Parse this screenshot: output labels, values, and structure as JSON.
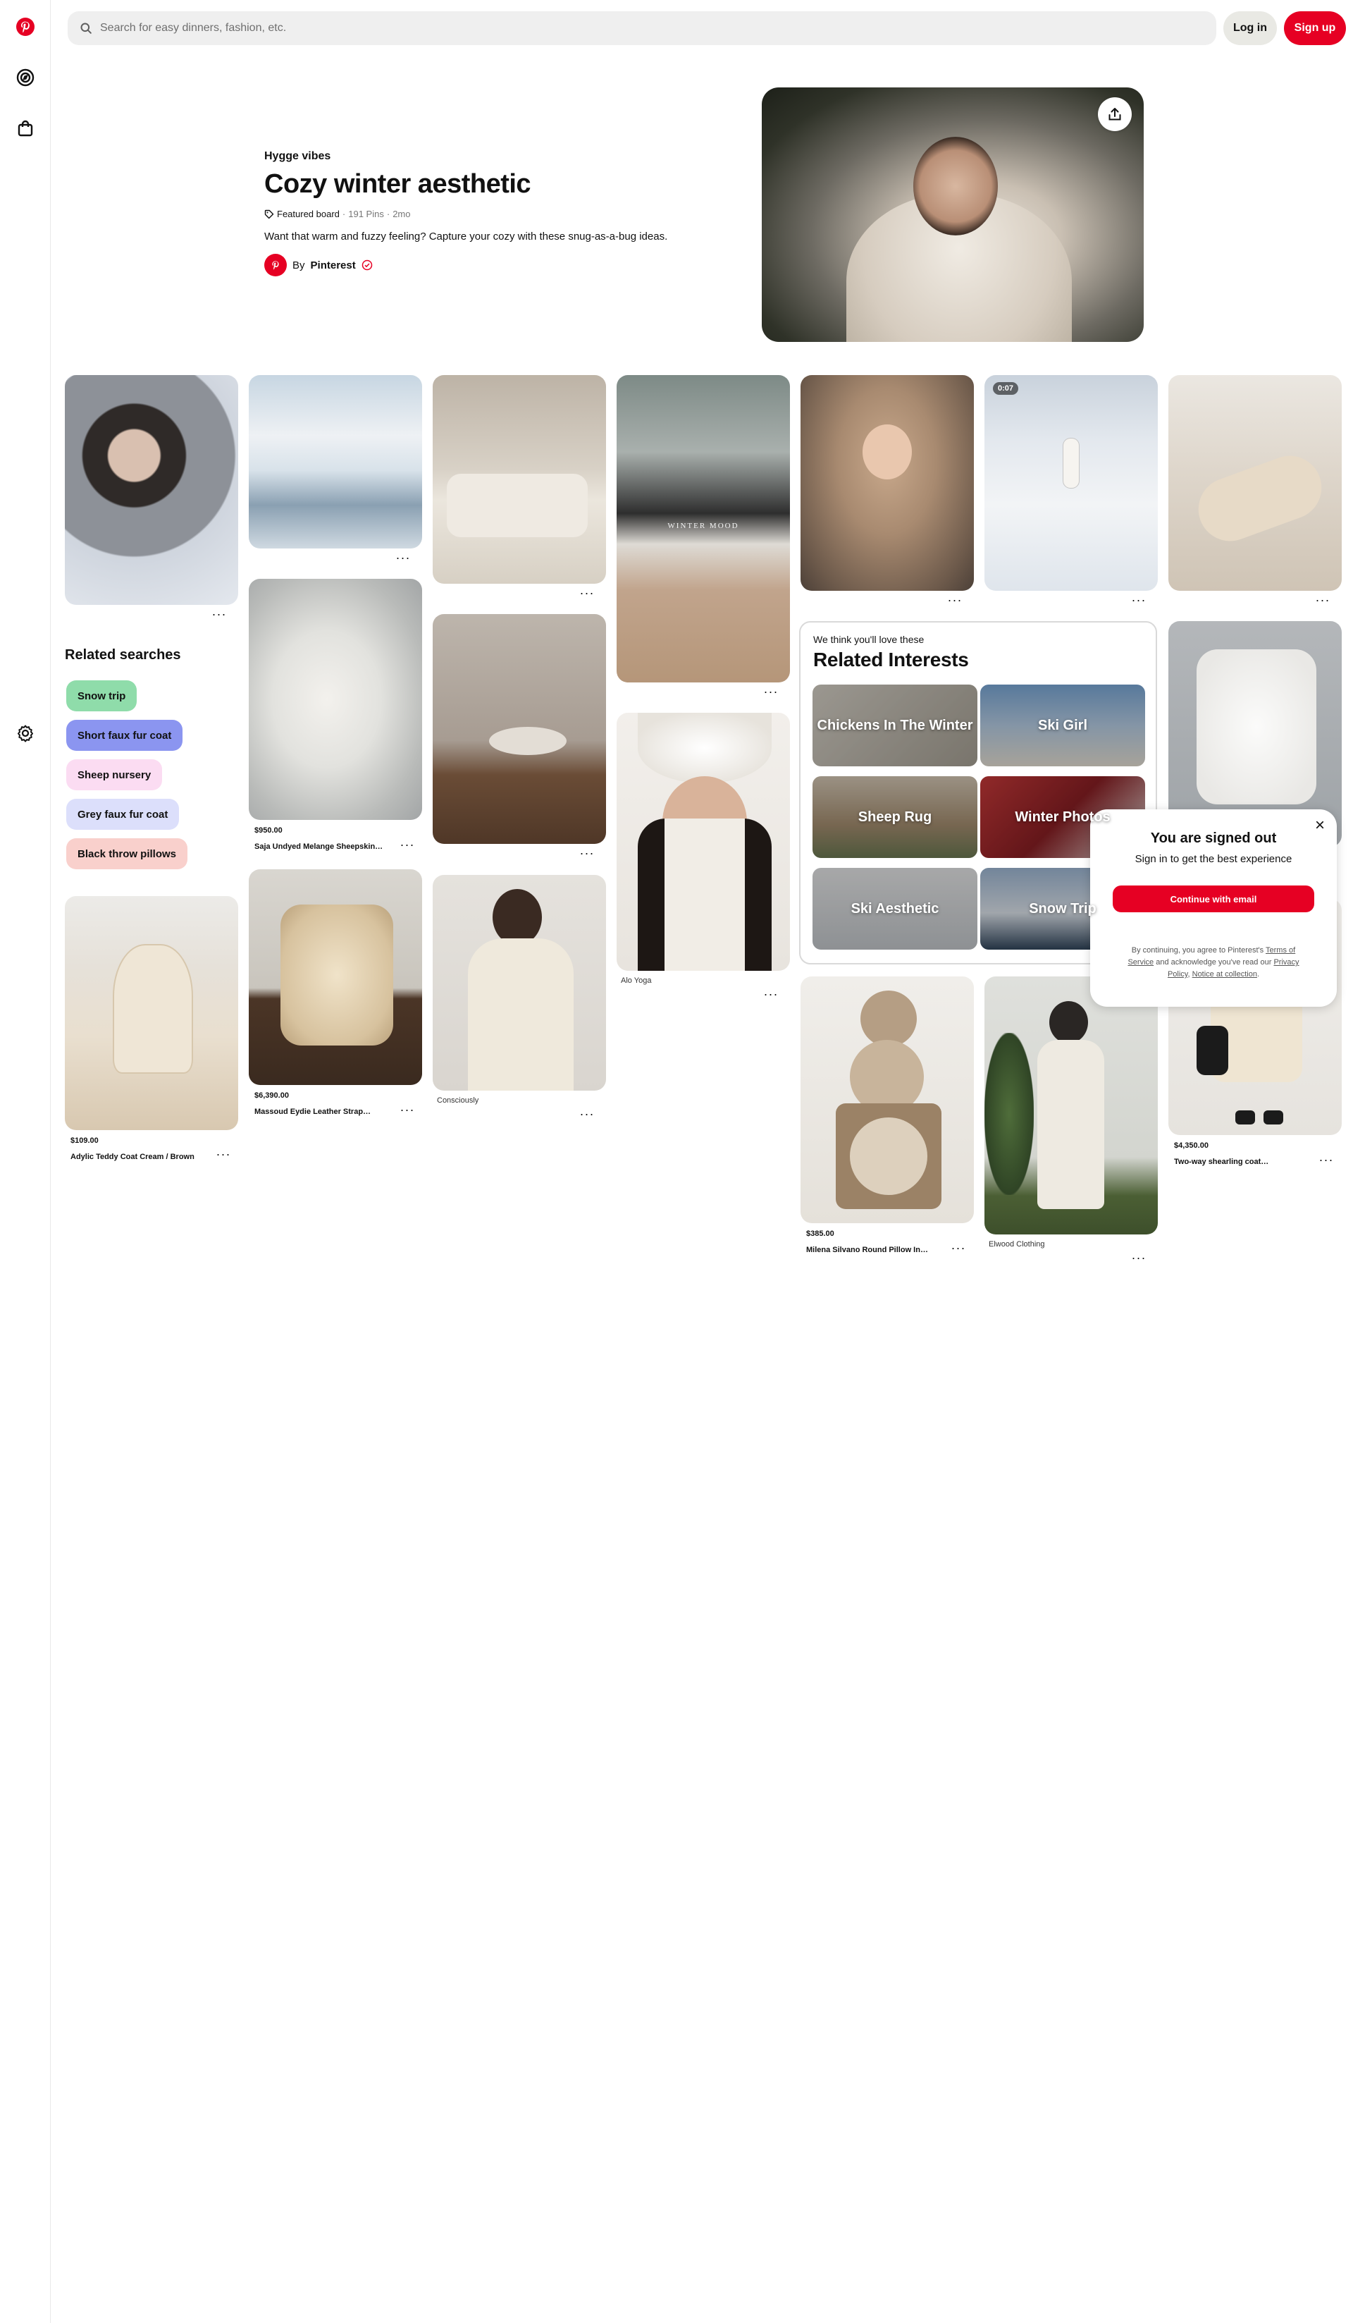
{
  "header": {
    "search_placeholder": "Search for easy dinners, fashion, etc.",
    "login_label": "Log in",
    "signup_label": "Sign up"
  },
  "rail": {
    "icons": [
      "pinterest-logo",
      "explore-compass-icon",
      "shop-bag-icon",
      "settings-gear-icon"
    ]
  },
  "board": {
    "kicker": "Hygge vibes",
    "title": "Cozy winter aesthetic",
    "featured_label": "Featured board",
    "separator": "·",
    "pin_count": "191 Pins",
    "age": "2mo",
    "description": "Want that warm and fuzzy feeling? Capture your cozy with these snug-as-a-bug ideas.",
    "by_prefix": "By",
    "author": "Pinterest"
  },
  "pins": {
    "more_label": "···",
    "p_sheepskin": {
      "price": "$950.00",
      "title": "Saja Undyed Melange Sheepskin…"
    },
    "p_chair": {
      "price": "$6,390.00",
      "title": "Massoud Eydie Leather Strap…"
    },
    "p_sweater": {
      "source": "Consciously"
    },
    "p_coat": {
      "price": "$109.00",
      "title": "Adylic Teddy Coat Cream / Brown"
    },
    "p_hat": {
      "source": "Alo Yoga"
    },
    "p_pillow": {
      "price": "$385.00",
      "title": "Milena Silvano Round Pillow In…"
    },
    "p_elwood": {
      "source": "Elwood Clothing"
    },
    "p_shearling": {
      "price": "$4,350.00",
      "title": "Two-way shearling coat…"
    },
    "p_video": {
      "duration": "0:07"
    },
    "p_socks": {
      "overlay": "WINTER MOOD"
    }
  },
  "related_searches": {
    "title": "Related searches",
    "chips": [
      {
        "label": "Snow trip",
        "color": "#8fdcaa"
      },
      {
        "label": "Short faux fur coat",
        "color": "#8b95f0"
      },
      {
        "label": "Sheep nursery",
        "color": "#fbdcf2"
      },
      {
        "label": "Grey faux fur coat",
        "color": "#dcdffb"
      },
      {
        "label": "Black throw pillows",
        "color": "#f9d0cc"
      }
    ]
  },
  "related_interests": {
    "kicker": "We think you'll love these",
    "title": "Related Interests",
    "tiles": [
      {
        "label": "Chickens In The Winter"
      },
      {
        "label": "Ski Girl"
      },
      {
        "label": "Sheep Rug"
      },
      {
        "label": "Winter Photos"
      },
      {
        "label": "Ski Aesthetic"
      },
      {
        "label": "Snow Trip"
      }
    ]
  },
  "popup": {
    "title": "You are signed out",
    "subtitle": "Sign in to get the best experience",
    "button_label": "Continue with email",
    "legal_prefix": "By continuing, you agree to Pinterest's",
    "terms_label": "Terms of Service",
    "legal_middle": "and acknowledge you've read our",
    "privacy_label": "Privacy Policy",
    "notice_label": "Notice at collection",
    "close_icon": "×"
  },
  "colors": {
    "brand_red": "#e60023",
    "verified_red": "#e60023",
    "search_bg": "#efefef",
    "login_bg": "#e9e9e4"
  }
}
